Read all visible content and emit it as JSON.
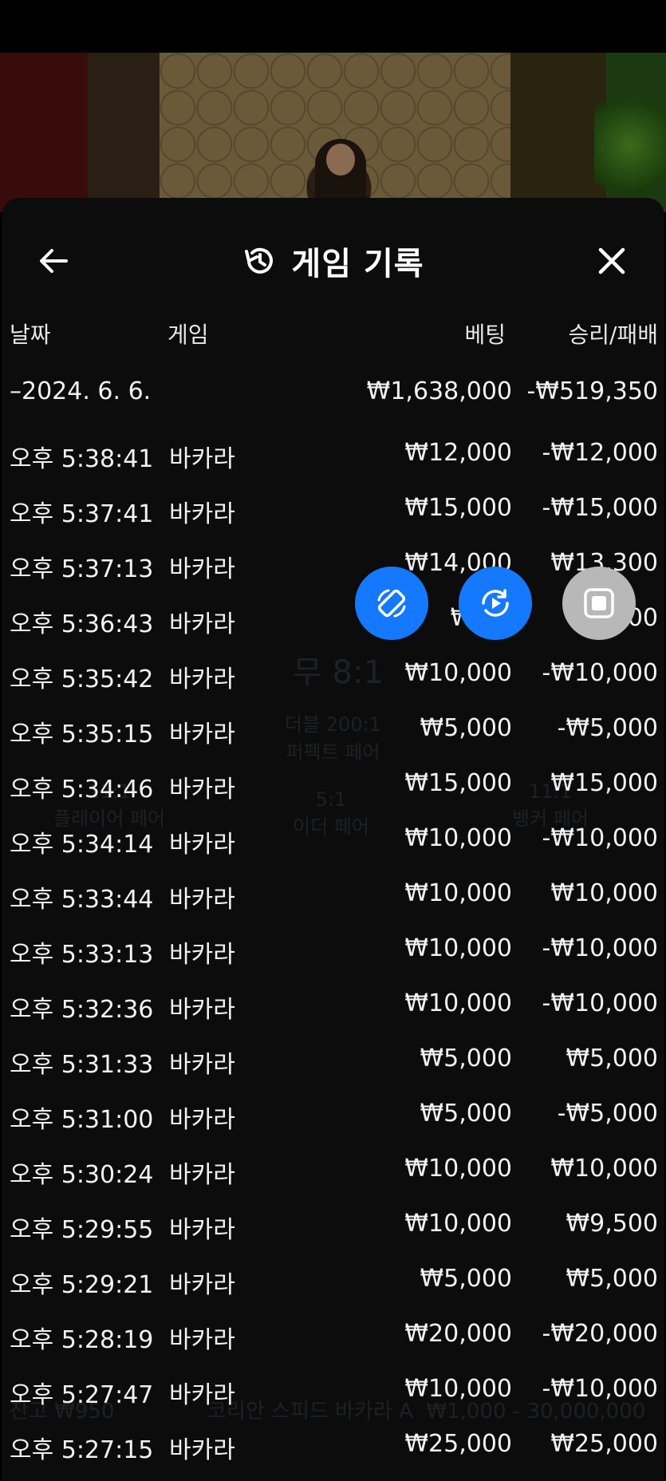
{
  "header": {
    "title": "게임 기록"
  },
  "columns": {
    "date": "날짜",
    "game": "게임",
    "bet": "베팅",
    "win": "승리/패배"
  },
  "summary": {
    "date": "–2024. 6. 6.",
    "bet": "₩1,638,000",
    "win": "-₩519,350"
  },
  "rows": [
    {
      "time": "오후 5:38:41",
      "game": "바카라",
      "bet": "₩12,000",
      "win": "-₩12,000"
    },
    {
      "time": "오후 5:37:41",
      "game": "바카라",
      "bet": "₩15,000",
      "win": "-₩15,000"
    },
    {
      "time": "오후 5:37:13",
      "game": "바카라",
      "bet": "₩14,000",
      "win": "₩13,300"
    },
    {
      "time": "오후 5:36:43",
      "game": "바카라",
      "bet": "₩15,",
      "win": "-₩  00"
    },
    {
      "time": "오후 5:35:42",
      "game": "바카라",
      "bet": "₩10,000",
      "win": "-₩10,000"
    },
    {
      "time": "오후 5:35:15",
      "game": "바카라",
      "bet": "₩5,000",
      "win": "-₩5,000"
    },
    {
      "time": "오후 5:34:46",
      "game": "바카라",
      "bet": "₩15,000",
      "win": "₩15,000"
    },
    {
      "time": "오후 5:34:14",
      "game": "바카라",
      "bet": "₩10,000",
      "win": "-₩10,000"
    },
    {
      "time": "오후 5:33:44",
      "game": "바카라",
      "bet": "₩10,000",
      "win": "₩10,000"
    },
    {
      "time": "오후 5:33:13",
      "game": "바카라",
      "bet": "₩10,000",
      "win": "-₩10,000"
    },
    {
      "time": "오후 5:32:36",
      "game": "바카라",
      "bet": "₩10,000",
      "win": "-₩10,000"
    },
    {
      "time": "오후 5:31:33",
      "game": "바카라",
      "bet": "₩5,000",
      "win": "₩5,000"
    },
    {
      "time": "오후 5:31:00",
      "game": "바카라",
      "bet": "₩5,000",
      "win": "-₩5,000"
    },
    {
      "time": "오후 5:30:24",
      "game": "바카라",
      "bet": "₩10,000",
      "win": "₩10,000"
    },
    {
      "time": "오후 5:29:55",
      "game": "바카라",
      "bet": "₩10,000",
      "win": "₩9,500"
    },
    {
      "time": "오후 5:29:21",
      "game": "바카라",
      "bet": "₩5,000",
      "win": "₩5,000"
    },
    {
      "time": "오후 5:28:19",
      "game": "바카라",
      "bet": "₩20,000",
      "win": "-₩20,000"
    },
    {
      "time": "오후 5:27:47",
      "game": "바카라",
      "bet": "₩10,000",
      "win": "-₩10,000"
    },
    {
      "time": "오후 5:27:15",
      "game": "바카라",
      "bet": "₩25,000",
      "win": "₩25,000"
    }
  ],
  "background": {
    "odds_tie": "무 8:1",
    "perfect_pair": "더블 200:1\n퍼펙트 페어",
    "player_pair": "11:1\n플레이어 페어",
    "either_pair": "5:1\n이더 페어",
    "banker_pair": "11:1\n뱅커 페어",
    "balance": "잔고 ₩950",
    "table_name": "코리안 스피드 바카라 A  ₩1,000 - 30,000,000"
  },
  "colors": {
    "fab_blue": "#1479ff",
    "fab_gray": "#b8b8b8",
    "panel": "#0c0c0c"
  },
  "icons": {
    "back": "arrow-left-icon",
    "history": "history-icon",
    "close": "close-icon",
    "rotate": "screen-rotate-icon",
    "replay": "replay-icon",
    "stop": "stop-icon"
  }
}
